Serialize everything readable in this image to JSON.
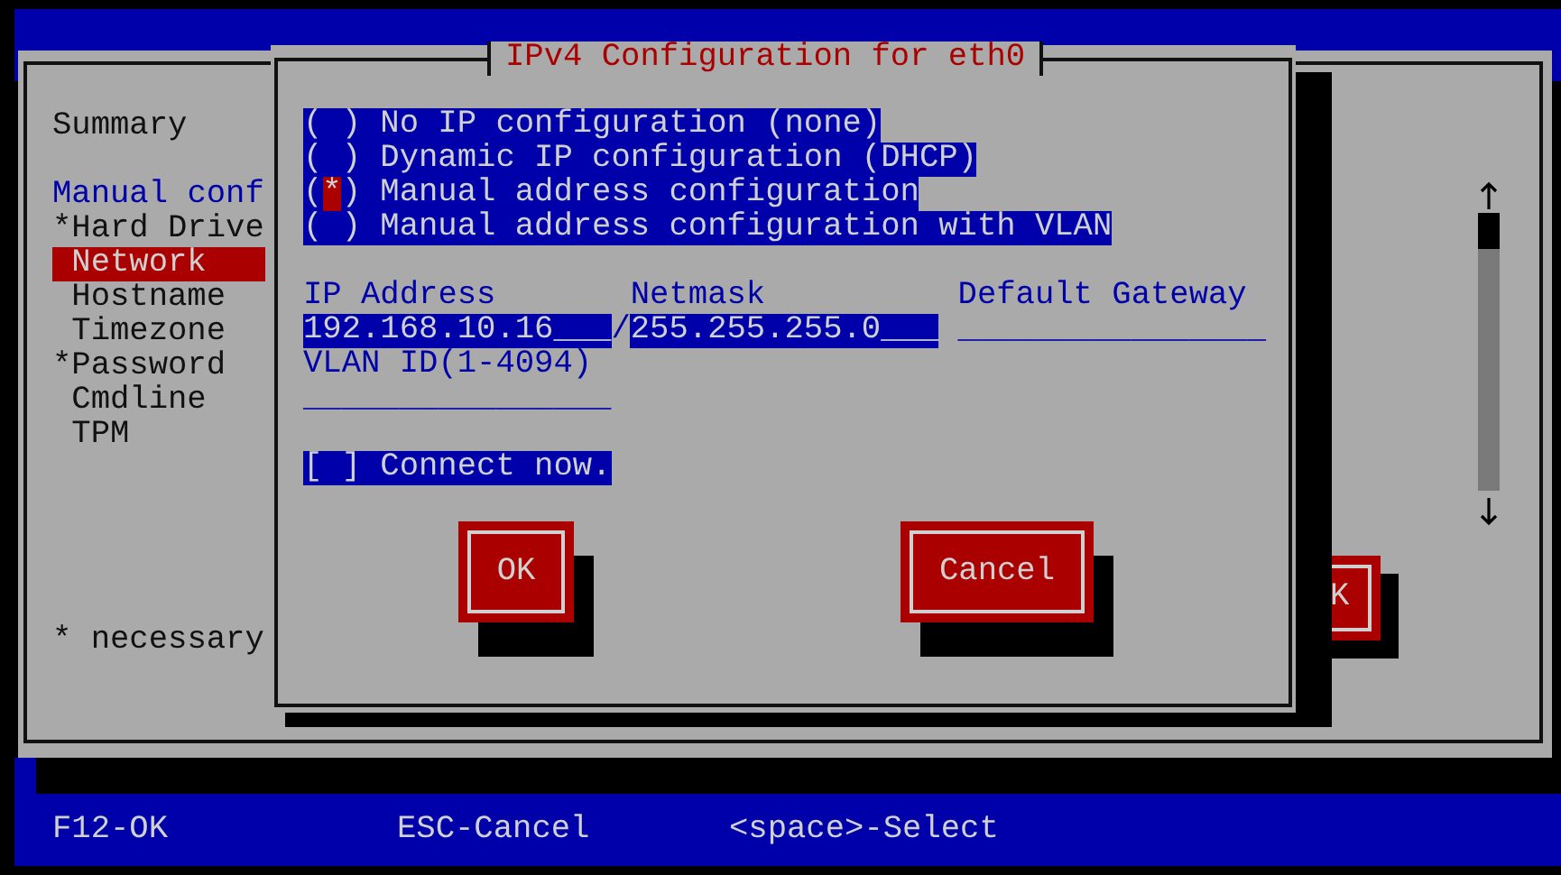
{
  "background_window": {
    "sidebar": [
      {
        "label": "Summary",
        "kind": "item",
        "selected": false
      },
      {
        "label": "Manual conf",
        "kind": "heading",
        "children": [
          {
            "label": "*Hard Drive",
            "required": true,
            "selected": false
          },
          {
            "label": "Network",
            "required": false,
            "selected": true
          },
          {
            "label": "Hostname",
            "required": false,
            "selected": false
          },
          {
            "label": "Timezone",
            "required": false,
            "selected": false
          },
          {
            "label": "*Password",
            "required": true,
            "selected": false
          },
          {
            "label": "Cmdline",
            "required": false,
            "selected": false
          },
          {
            "label": "TPM",
            "required": false,
            "selected": false
          }
        ]
      }
    ],
    "footnote": "* necessary",
    "partial_button": "K"
  },
  "dialog": {
    "title": "IPv4 Configuration for eth0",
    "radio_group": {
      "open": "(",
      "close": ")",
      "mark": "*",
      "options": [
        {
          "label": "No IP configuration (none)",
          "selected": false
        },
        {
          "label": "Dynamic IP configuration (DHCP)",
          "selected": false
        },
        {
          "label": "Manual address configuration",
          "selected": true
        },
        {
          "label": "Manual address configuration with VLAN",
          "selected": false
        }
      ]
    },
    "fields": [
      {
        "label": "IP Address",
        "value": "192.168.10.16___",
        "highlighted": true,
        "separator": "/"
      },
      {
        "label": "Netmask",
        "value": "255.255.255.0___",
        "highlighted": true
      },
      {
        "label": "Default Gateway",
        "value": "________________",
        "highlighted": false
      }
    ],
    "vlan": {
      "label": "VLAN ID(1-4094)",
      "value": "________________",
      "highlighted": false
    },
    "checkbox": {
      "open": "[",
      "close": "]",
      "label": "Connect now.",
      "checked": false
    },
    "buttons": [
      {
        "label": "OK"
      },
      {
        "label": "Cancel"
      }
    ]
  },
  "status_bar": [
    "F12-OK",
    "ESC-Cancel",
    "<space>-Select"
  ]
}
